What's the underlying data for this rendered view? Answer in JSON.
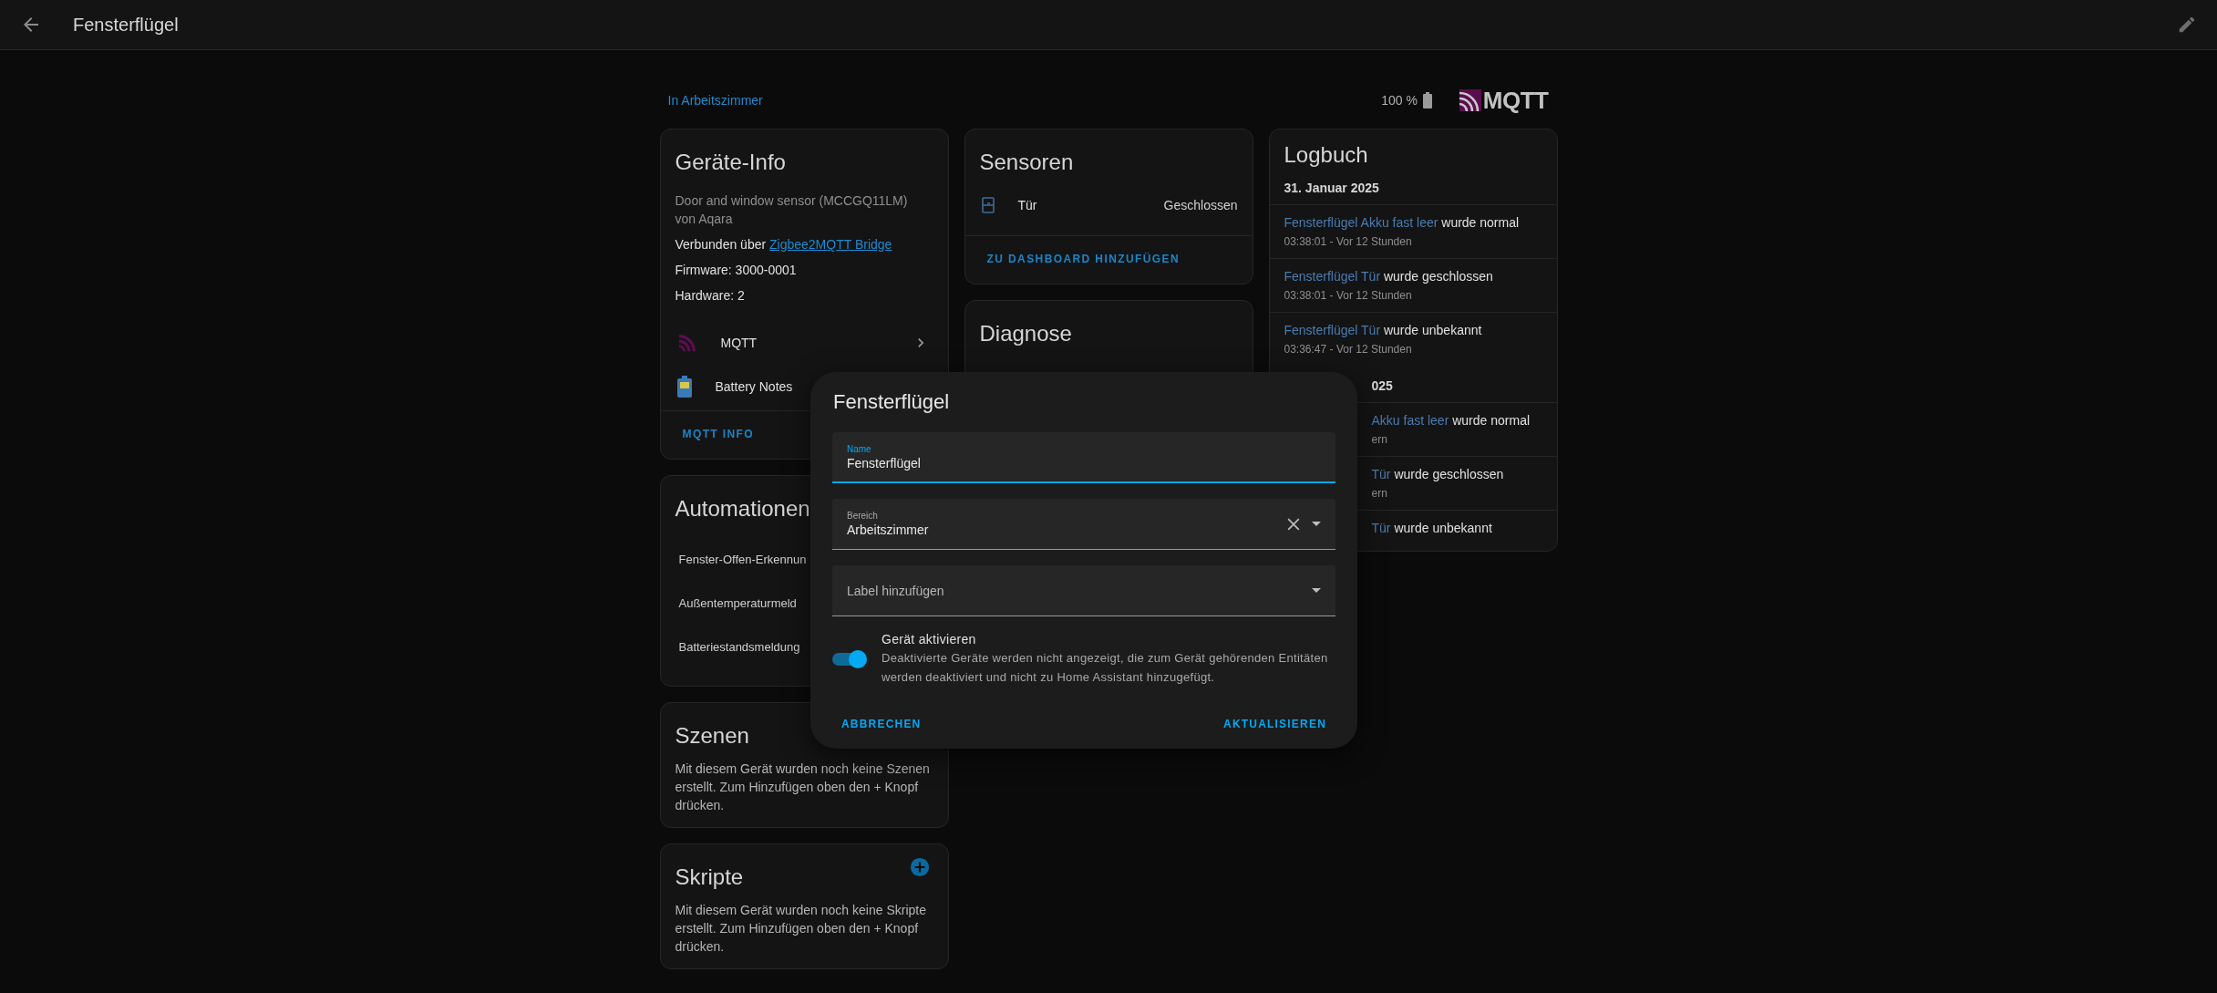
{
  "topbar": {
    "title": "Fensterflügel"
  },
  "header": {
    "area_link": "In Arbeitszimmer",
    "battery_reading": "100 %",
    "logo_text": "MQTT"
  },
  "device_info": {
    "title": "Geräte-Info",
    "model": "Door and window sensor (MCCGQ11LM)",
    "manufacturer": "von Aqara",
    "connected_prefix": "Verbunden über",
    "connected_link": "Zigbee2MQTT Bridge",
    "firmware": "Firmware: 3000-0001",
    "hardware": "Hardware: 2",
    "integrations": [
      {
        "kind": "mqtt",
        "label": "MQTT",
        "chevron": true
      },
      {
        "kind": "battery",
        "label": "Battery Notes",
        "chevron": false
      }
    ],
    "action": "MQTT INFO"
  },
  "automations": {
    "title": "Automationen",
    "items": [
      "Fenster-Offen-Erkennun",
      "Außentemperaturmeld",
      "Batteriestandsmeldung"
    ]
  },
  "scenes": {
    "title": "Szenen",
    "text": "Mit diesem Gerät wurden noch keine Szenen erstellt. Zum Hinzufügen oben den + Knopf drücken."
  },
  "scripts": {
    "title": "Skripte",
    "text": "Mit diesem Gerät wurden noch keine Skripte erstellt. Zum Hinzufügen oben den + Knopf drücken."
  },
  "sensors": {
    "title": "Sensoren",
    "entities": [
      {
        "name": "Tür",
        "state": "Geschlossen"
      }
    ],
    "action": "ZU DASHBOARD HINZUFÜGEN"
  },
  "diagnostics": {
    "title": "Diagnose"
  },
  "logbook": {
    "title": "Logbuch",
    "groups": [
      {
        "date": "31. Januar 2025",
        "partly_covered": false,
        "entries": [
          {
            "entity": "Fensterflügel Akku fast leer",
            "message": "wurde normal",
            "time": "03:38:01 - Vor 12 Stunden"
          },
          {
            "entity": "Fensterflügel Tür",
            "message": "wurde geschlossen",
            "time": "03:38:01 - Vor 12 Stunden"
          },
          {
            "entity": "Fensterflügel Tür",
            "message": "wurde unbekannt",
            "time": "03:36:47 - Vor 12 Stunden"
          }
        ]
      },
      {
        "date": "025",
        "partly_covered": true,
        "entries": [
          {
            "entity": "Akku fast leer",
            "message": "wurde normal",
            "time": "ern"
          },
          {
            "entity": "Tür",
            "message": "wurde geschlossen",
            "time": "ern"
          },
          {
            "entity": "Tür",
            "message": "wurde unbekannt"
          }
        ]
      }
    ]
  },
  "dialog": {
    "title": "Fensterflügel",
    "fields": [
      {
        "kind": "text",
        "label": "Name",
        "value": "Fensterflügel",
        "focused": true
      },
      {
        "kind": "select",
        "label": "Bereich",
        "value": "Arbeitszimmer",
        "clearable": true,
        "focused": false
      },
      {
        "kind": "select",
        "placeholder": "Label hinzufügen",
        "clearable": false,
        "focused": false
      }
    ],
    "enable": {
      "on": true,
      "title": "Gerät aktivieren",
      "description": "Deaktivierte Geräte werden nicht angezeigt, die zum Gerät gehörenden Entitäten werden deaktiviert und nicht zu Home Assistant hinzugefügt."
    },
    "buttons": [
      "ABBRECHEN",
      "AKTUALISIEREN"
    ]
  }
}
